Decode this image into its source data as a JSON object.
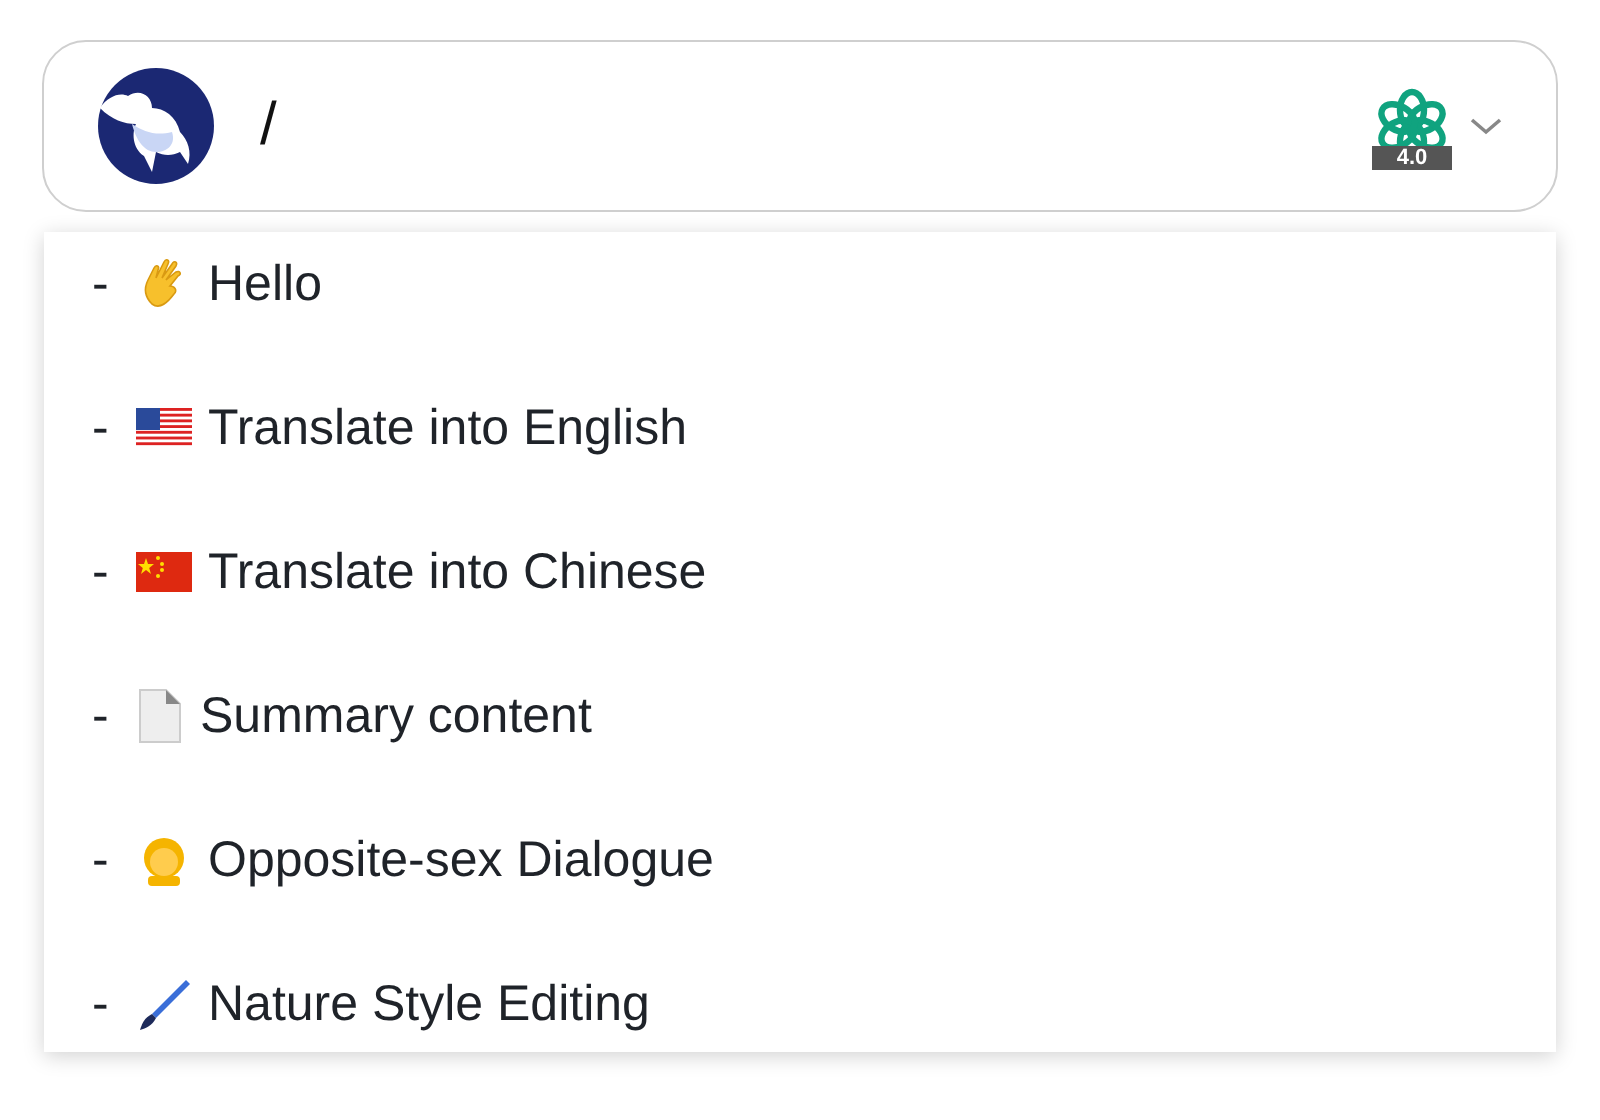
{
  "input": {
    "value": "/"
  },
  "model": {
    "badge": "4.0"
  },
  "suggestions": [
    {
      "bullet": "-",
      "label": "Hello"
    },
    {
      "bullet": "-",
      "label": "Translate into English"
    },
    {
      "bullet": "-",
      "label": "Translate into Chinese"
    },
    {
      "bullet": "-",
      "label": "Summary content"
    },
    {
      "bullet": "-",
      "label": "Opposite-sex Dialogue"
    },
    {
      "bullet": "-",
      "label": "Nature Style Editing"
    }
  ]
}
